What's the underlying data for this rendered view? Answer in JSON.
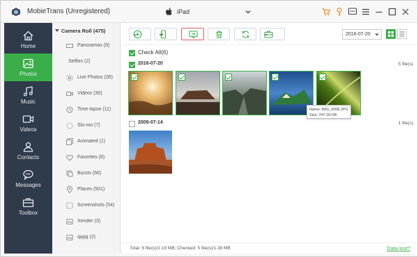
{
  "app": {
    "title": "MobieTrans (Unregistered)",
    "device": "iPad",
    "accent_color": "#3aae49",
    "sidebar_color": "#2f3a4b",
    "title_icons": [
      "cart-icon",
      "key-icon",
      "feedback-icon",
      "menu-icon",
      "minimize-icon",
      "maximize-icon",
      "close-icon"
    ]
  },
  "sidebar": {
    "items": [
      {
        "label": "Home",
        "icon": "home-icon",
        "active": false
      },
      {
        "label": "Photos",
        "icon": "photos-icon",
        "active": true
      },
      {
        "label": "Music",
        "icon": "music-icon",
        "active": false
      },
      {
        "label": "Videos",
        "icon": "video-icon",
        "active": false
      },
      {
        "label": "Contacts",
        "icon": "contacts-icon",
        "active": false
      },
      {
        "label": "Messages",
        "icon": "messages-icon",
        "active": false
      },
      {
        "label": "Toolbox",
        "icon": "toolbox-icon",
        "active": false
      }
    ]
  },
  "albums": {
    "header": "Camera Roll (475)",
    "items": [
      {
        "label": "Panoramas (8)",
        "icon": "panorama-icon"
      },
      {
        "label": "Selfies (2)",
        "icon": "none"
      },
      {
        "label": "Live Photos (35)",
        "icon": "live-photo-icon"
      },
      {
        "label": "Videos (30)",
        "icon": "video-icon"
      },
      {
        "label": "Time-lapse (11)",
        "icon": "timelapse-icon"
      },
      {
        "label": "Slo-mo (7)",
        "icon": "slomo-icon"
      },
      {
        "label": "Animated (1)",
        "icon": "animated-icon"
      },
      {
        "label": "Favorites (8)",
        "icon": "heart-icon"
      },
      {
        "label": "Bursts (66)",
        "icon": "bursts-icon"
      },
      {
        "label": "Places (501)",
        "icon": "place-icon"
      },
      {
        "label": "Screenshots (54)",
        "icon": "screenshot-icon"
      },
      {
        "label": "Xender (3)",
        "icon": "folder-icon"
      },
      {
        "label": "qqqq (2)",
        "icon": "folder-icon"
      }
    ]
  },
  "toolbar": {
    "buttons": [
      "add-icon",
      "export-to-device-icon",
      "export-to-pc-icon",
      "delete-icon",
      "refresh-icon",
      "more-icon"
    ],
    "date_filter": "2016-07-20"
  },
  "content": {
    "check_all_label": "Check All(6)",
    "groups": [
      {
        "date": "2016-07-20",
        "count": "5 file(s)",
        "checked": true,
        "photos": 5
      },
      {
        "date": "2009-07-14",
        "count": "1 file(s)",
        "checked": false,
        "photos": 1
      }
    ],
    "tooltip": {
      "name": "Name: IMG_0008.JPG",
      "size": "Size: 247.00 KB"
    }
  },
  "status": {
    "summary": "Total: 6 file(s)/2.19 MB; Checked: 5 file(s)/1.38 MB",
    "link": "Data lost?"
  }
}
